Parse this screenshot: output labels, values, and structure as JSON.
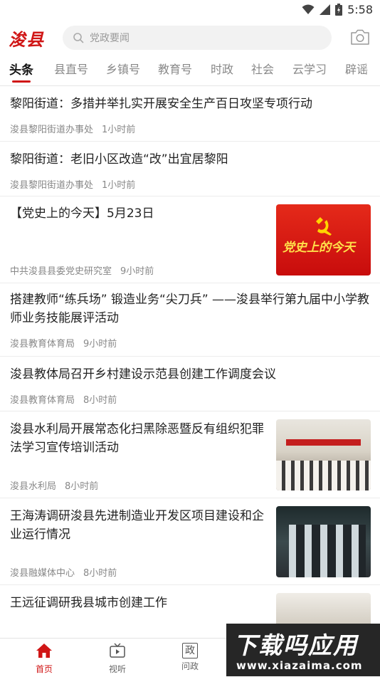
{
  "status_bar": {
    "time": "5:58"
  },
  "header": {
    "logo_text": "浚县",
    "search_placeholder": "党政要闻"
  },
  "tabs": [
    {
      "label": "头条"
    },
    {
      "label": "县直号"
    },
    {
      "label": "乡镇号"
    },
    {
      "label": "教育号"
    },
    {
      "label": "时政"
    },
    {
      "label": "社会"
    },
    {
      "label": "云学习"
    },
    {
      "label": "辟谣"
    }
  ],
  "feed": [
    {
      "title": "黎阳街道：多措并举扎实开展安全生产百日攻坚专项行动",
      "source": "浚县黎阳街道办事处",
      "time": "1小时前"
    },
    {
      "title": "黎阳街道：老旧小区改造“改”出宜居黎阳",
      "source": "浚县黎阳街道办事处",
      "time": "1小时前"
    },
    {
      "title": "【党史上的今天】5月23日",
      "source": "中共浚县县委党史研究室",
      "time": "9小时前",
      "thumb_text": "党史上的今天"
    },
    {
      "title": "搭建教师“练兵场” 锻造业务“尖刀兵” ——浚县举行第九届中小学教师业务技能展评活动",
      "source": "浚县教育体育局",
      "time": "9小时前"
    },
    {
      "title": "浚县教体局召开乡村建设示范县创建工作调度会议",
      "source": "浚县教育体育局",
      "time": "8小时前"
    },
    {
      "title": "浚县水利局开展常态化扫黑除恶暨反有组织犯罪法学习宣传培训活动",
      "source": "浚县水利局",
      "time": "8小时前"
    },
    {
      "title": "王海涛调研浚县先进制造业开发区项目建设和企业运行情况",
      "source": "浚县融媒体中心",
      "time": "8小时前"
    },
    {
      "title": "王远征调研我县城市创建工作"
    }
  ],
  "bottom_nav": [
    {
      "label": "首页",
      "icon": "home-icon"
    },
    {
      "label": "视听",
      "icon": "tv-icon"
    },
    {
      "label": "问政",
      "icon": "zheng-icon",
      "glyph": "政"
    }
  ],
  "watermark": {
    "big_text": "下载吗应用",
    "url": "www.xiazaima.com"
  },
  "colors": {
    "accent": "#d01616",
    "text": "#222222",
    "meta": "#888888"
  }
}
